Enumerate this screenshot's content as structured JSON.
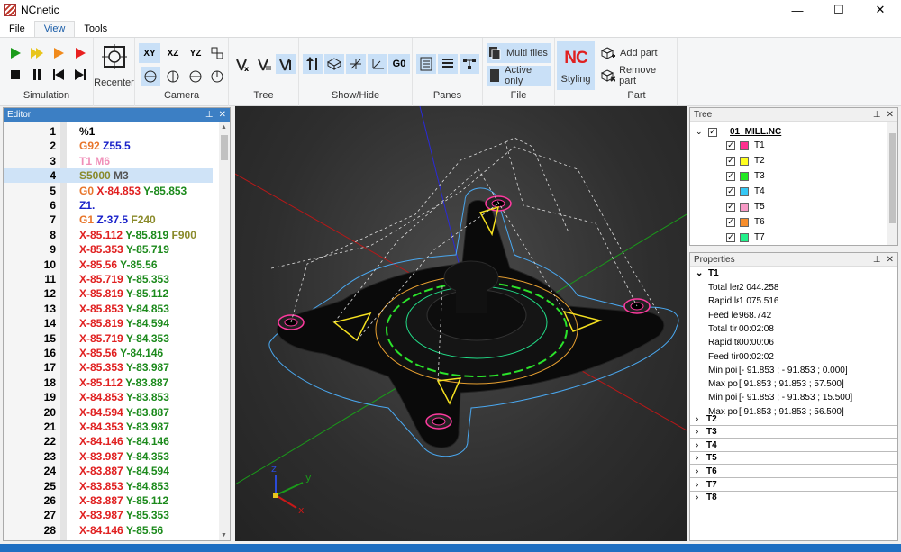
{
  "window": {
    "title": "NCnetic",
    "min_glyph": "—",
    "max_glyph": "☐",
    "close_glyph": "✕"
  },
  "menu": [
    "File",
    "View",
    "Tools"
  ],
  "ribbon": {
    "simulation": {
      "label": "Simulation"
    },
    "recenter": {
      "label": "Recenter"
    },
    "camera": {
      "label": "Camera",
      "planes": [
        "XY",
        "XZ",
        "YZ"
      ]
    },
    "tree": {
      "label": "Tree"
    },
    "showhide": {
      "label": "Show/Hide",
      "g0": "G0"
    },
    "panes": {
      "label": "Panes"
    },
    "file": {
      "label": "File",
      "multi": "Multi files",
      "active": "Active only"
    },
    "styling": {
      "label": "Styling",
      "logo": "NC"
    },
    "part": {
      "label": "Part",
      "add": "Add part",
      "remove": "Remove part"
    }
  },
  "editor": {
    "title": "Editor",
    "lines": [
      {
        "n": "1",
        "t": [
          [
            "%1",
            "#000"
          ]
        ]
      },
      {
        "n": "2",
        "t": [
          [
            "G92 ",
            "#e8762b"
          ],
          [
            "Z55.5",
            "#1a22c9"
          ]
        ]
      },
      {
        "n": "3",
        "t": [
          [
            "T1 M6",
            "#f08fb8"
          ]
        ]
      },
      {
        "n": "4",
        "t": [
          [
            "S5000 ",
            "#8a8a2a"
          ],
          [
            "M3",
            "#555555"
          ]
        ],
        "hl": true
      },
      {
        "n": "5",
        "t": [
          [
            "G0 ",
            "#e8762b"
          ],
          [
            "X-84.853 ",
            "#e02020"
          ],
          [
            "Y-85.853",
            "#1c8a1c"
          ]
        ]
      },
      {
        "n": "6",
        "t": [
          [
            "Z1.",
            "#1a22c9"
          ]
        ]
      },
      {
        "n": "7",
        "t": [
          [
            "G1 ",
            "#e8762b"
          ],
          [
            "Z-37.5 ",
            "#1a22c9"
          ],
          [
            "F240",
            "#8a8a2a"
          ]
        ]
      },
      {
        "n": "8",
        "t": [
          [
            "X-85.112 ",
            "#e02020"
          ],
          [
            "Y-85.819 ",
            "#1c8a1c"
          ],
          [
            "F900",
            "#8a8a2a"
          ]
        ]
      },
      {
        "n": "9",
        "t": [
          [
            "X-85.353 ",
            "#e02020"
          ],
          [
            "Y-85.719",
            "#1c8a1c"
          ]
        ]
      },
      {
        "n": "10",
        "t": [
          [
            "X-85.56 ",
            "#e02020"
          ],
          [
            "Y-85.56",
            "#1c8a1c"
          ]
        ]
      },
      {
        "n": "11",
        "t": [
          [
            "X-85.719 ",
            "#e02020"
          ],
          [
            "Y-85.353",
            "#1c8a1c"
          ]
        ]
      },
      {
        "n": "12",
        "t": [
          [
            "X-85.819 ",
            "#e02020"
          ],
          [
            "Y-85.112",
            "#1c8a1c"
          ]
        ]
      },
      {
        "n": "13",
        "t": [
          [
            "X-85.853 ",
            "#e02020"
          ],
          [
            "Y-84.853",
            "#1c8a1c"
          ]
        ]
      },
      {
        "n": "14",
        "t": [
          [
            "X-85.819 ",
            "#e02020"
          ],
          [
            "Y-84.594",
            "#1c8a1c"
          ]
        ]
      },
      {
        "n": "15",
        "t": [
          [
            "X-85.719 ",
            "#e02020"
          ],
          [
            "Y-84.353",
            "#1c8a1c"
          ]
        ]
      },
      {
        "n": "16",
        "t": [
          [
            "X-85.56 ",
            "#e02020"
          ],
          [
            "Y-84.146",
            "#1c8a1c"
          ]
        ]
      },
      {
        "n": "17",
        "t": [
          [
            "X-85.353 ",
            "#e02020"
          ],
          [
            "Y-83.987",
            "#1c8a1c"
          ]
        ]
      },
      {
        "n": "18",
        "t": [
          [
            "X-85.112 ",
            "#e02020"
          ],
          [
            "Y-83.887",
            "#1c8a1c"
          ]
        ]
      },
      {
        "n": "19",
        "t": [
          [
            "X-84.853 ",
            "#e02020"
          ],
          [
            "Y-83.853",
            "#1c8a1c"
          ]
        ]
      },
      {
        "n": "20",
        "t": [
          [
            "X-84.594 ",
            "#e02020"
          ],
          [
            "Y-83.887",
            "#1c8a1c"
          ]
        ]
      },
      {
        "n": "21",
        "t": [
          [
            "X-84.353 ",
            "#e02020"
          ],
          [
            "Y-83.987",
            "#1c8a1c"
          ]
        ]
      },
      {
        "n": "22",
        "t": [
          [
            "X-84.146 ",
            "#e02020"
          ],
          [
            "Y-84.146",
            "#1c8a1c"
          ]
        ]
      },
      {
        "n": "23",
        "t": [
          [
            "X-83.987 ",
            "#e02020"
          ],
          [
            "Y-84.353",
            "#1c8a1c"
          ]
        ]
      },
      {
        "n": "24",
        "t": [
          [
            "X-83.887 ",
            "#e02020"
          ],
          [
            "Y-84.594",
            "#1c8a1c"
          ]
        ]
      },
      {
        "n": "25",
        "t": [
          [
            "X-83.853 ",
            "#e02020"
          ],
          [
            "Y-84.853",
            "#1c8a1c"
          ]
        ]
      },
      {
        "n": "26",
        "t": [
          [
            "X-83.887 ",
            "#e02020"
          ],
          [
            "Y-85.112",
            "#1c8a1c"
          ]
        ]
      },
      {
        "n": "27",
        "t": [
          [
            "X-83.987 ",
            "#e02020"
          ],
          [
            "Y-85.353",
            "#1c8a1c"
          ]
        ]
      },
      {
        "n": "28",
        "t": [
          [
            "X-84.146 ",
            "#e02020"
          ],
          [
            "Y-85.56",
            "#1c8a1c"
          ]
        ]
      }
    ]
  },
  "tree": {
    "title": "Tree",
    "root": "01_MILL.NC",
    "tools": [
      {
        "name": "T1",
        "color": "#ff2f8f"
      },
      {
        "name": "T2",
        "color": "#ffff20"
      },
      {
        "name": "T3",
        "color": "#22e822"
      },
      {
        "name": "T4",
        "color": "#35c8f5"
      },
      {
        "name": "T5",
        "color": "#f79ac6"
      },
      {
        "name": "T6",
        "color": "#f78e2c"
      },
      {
        "name": "T7",
        "color": "#22f08a"
      }
    ]
  },
  "properties": {
    "title": "Properties",
    "tool": "T1",
    "rows": [
      {
        "k": "Total ler",
        "v": "2 044.258"
      },
      {
        "k": "Rapid lε",
        "v": "1 075.516"
      },
      {
        "k": "Feed ler",
        "v": "968.742"
      },
      {
        "k": "Total tir",
        "v": "00:02:08"
      },
      {
        "k": "Rapid tε",
        "v": "00:00:06"
      },
      {
        "k": "Feed tir",
        "v": "00:02:02"
      },
      {
        "k": "Min poi",
        "v": "[- 91.853 ; - 91.853 ; 0.000]"
      },
      {
        "k": "Max po",
        "v": "[ 91.853 ; 91.853 ; 57.500]"
      },
      {
        "k": "Min poi",
        "v": "[- 91.853 ; - 91.853 ; 15.500]"
      },
      {
        "k": "Max po",
        "v": "[ 91.853 ; 91.853 ; 56.500]"
      }
    ],
    "groups": [
      "T2",
      "T3",
      "T4",
      "T5",
      "T6",
      "T7",
      "T8"
    ]
  },
  "axes": {
    "x": "x",
    "y": "y",
    "z": "z"
  }
}
